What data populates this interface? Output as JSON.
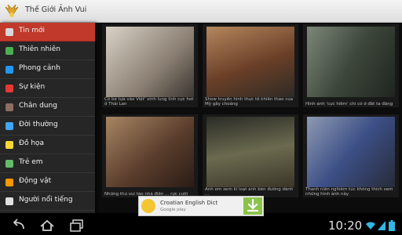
{
  "app": {
    "title": "Thế Giới Ảnh Vui",
    "logo_icon": "golden-wings-logo-icon"
  },
  "drawer": {
    "items": [
      {
        "label": "Tin mới",
        "icon": "folder-icon",
        "color": "#d9d9d9",
        "active": true
      },
      {
        "label": "Thiên nhiên",
        "icon": "tree-icon",
        "color": "#4caf50"
      },
      {
        "label": "Phong cảnh",
        "icon": "landscape-icon",
        "color": "#2196f3"
      },
      {
        "label": "Sự kiện",
        "icon": "calendar-icon",
        "color": "#e53935"
      },
      {
        "label": "Chân dung",
        "icon": "portrait-icon",
        "color": "#8d6e63"
      },
      {
        "label": "Đời thường",
        "icon": "people-icon",
        "color": "#42a5f5"
      },
      {
        "label": "Đồ họa",
        "icon": "palette-icon",
        "color": "#fdd835"
      },
      {
        "label": "Trẻ em",
        "icon": "children-icon",
        "color": "#66bb6a"
      },
      {
        "label": "Động vật",
        "icon": "paw-icon",
        "color": "#ff9800"
      },
      {
        "label": "Người nổi tiếng",
        "icon": "star-person-icon",
        "color": "#e0e0e0"
      }
    ]
  },
  "grid": {
    "tiles": [
      {
        "caption": "Cô bé tựa vào Việt' xinh lung linh cực hot ở Thái Lan",
        "color": "#b9b3ab"
      },
      {
        "caption": "Show truyền hình thực tế khiến thảo của Mỹ gây choáng",
        "color": "#7c4a2e"
      },
      {
        "caption": "Hình ảnh 'cực hiếm' chỉ có ở đất ta đàng",
        "color": "#576053"
      },
      {
        "caption": "Những thú vui táo nhà điền ... rực cười",
        "color": "#8a6b52"
      },
      {
        "caption": "Anh em xem kĩ loạt ảnh bên đường dành ...",
        "color": "#5b5a45"
      },
      {
        "caption": "Thanh niên nghiêm túc không thích xem những hình ảnh này",
        "color": "#56607a"
      }
    ]
  },
  "ad": {
    "title": "Croatian English Dict",
    "subtitle": "Google play",
    "download_icon": "download-icon"
  },
  "system_bar": {
    "time": "10:20",
    "buttons": [
      "back-icon",
      "home-icon",
      "recent-apps-icon"
    ],
    "status_icons": [
      "wifi-icon",
      "signal-icon",
      "battery-icon"
    ]
  }
}
